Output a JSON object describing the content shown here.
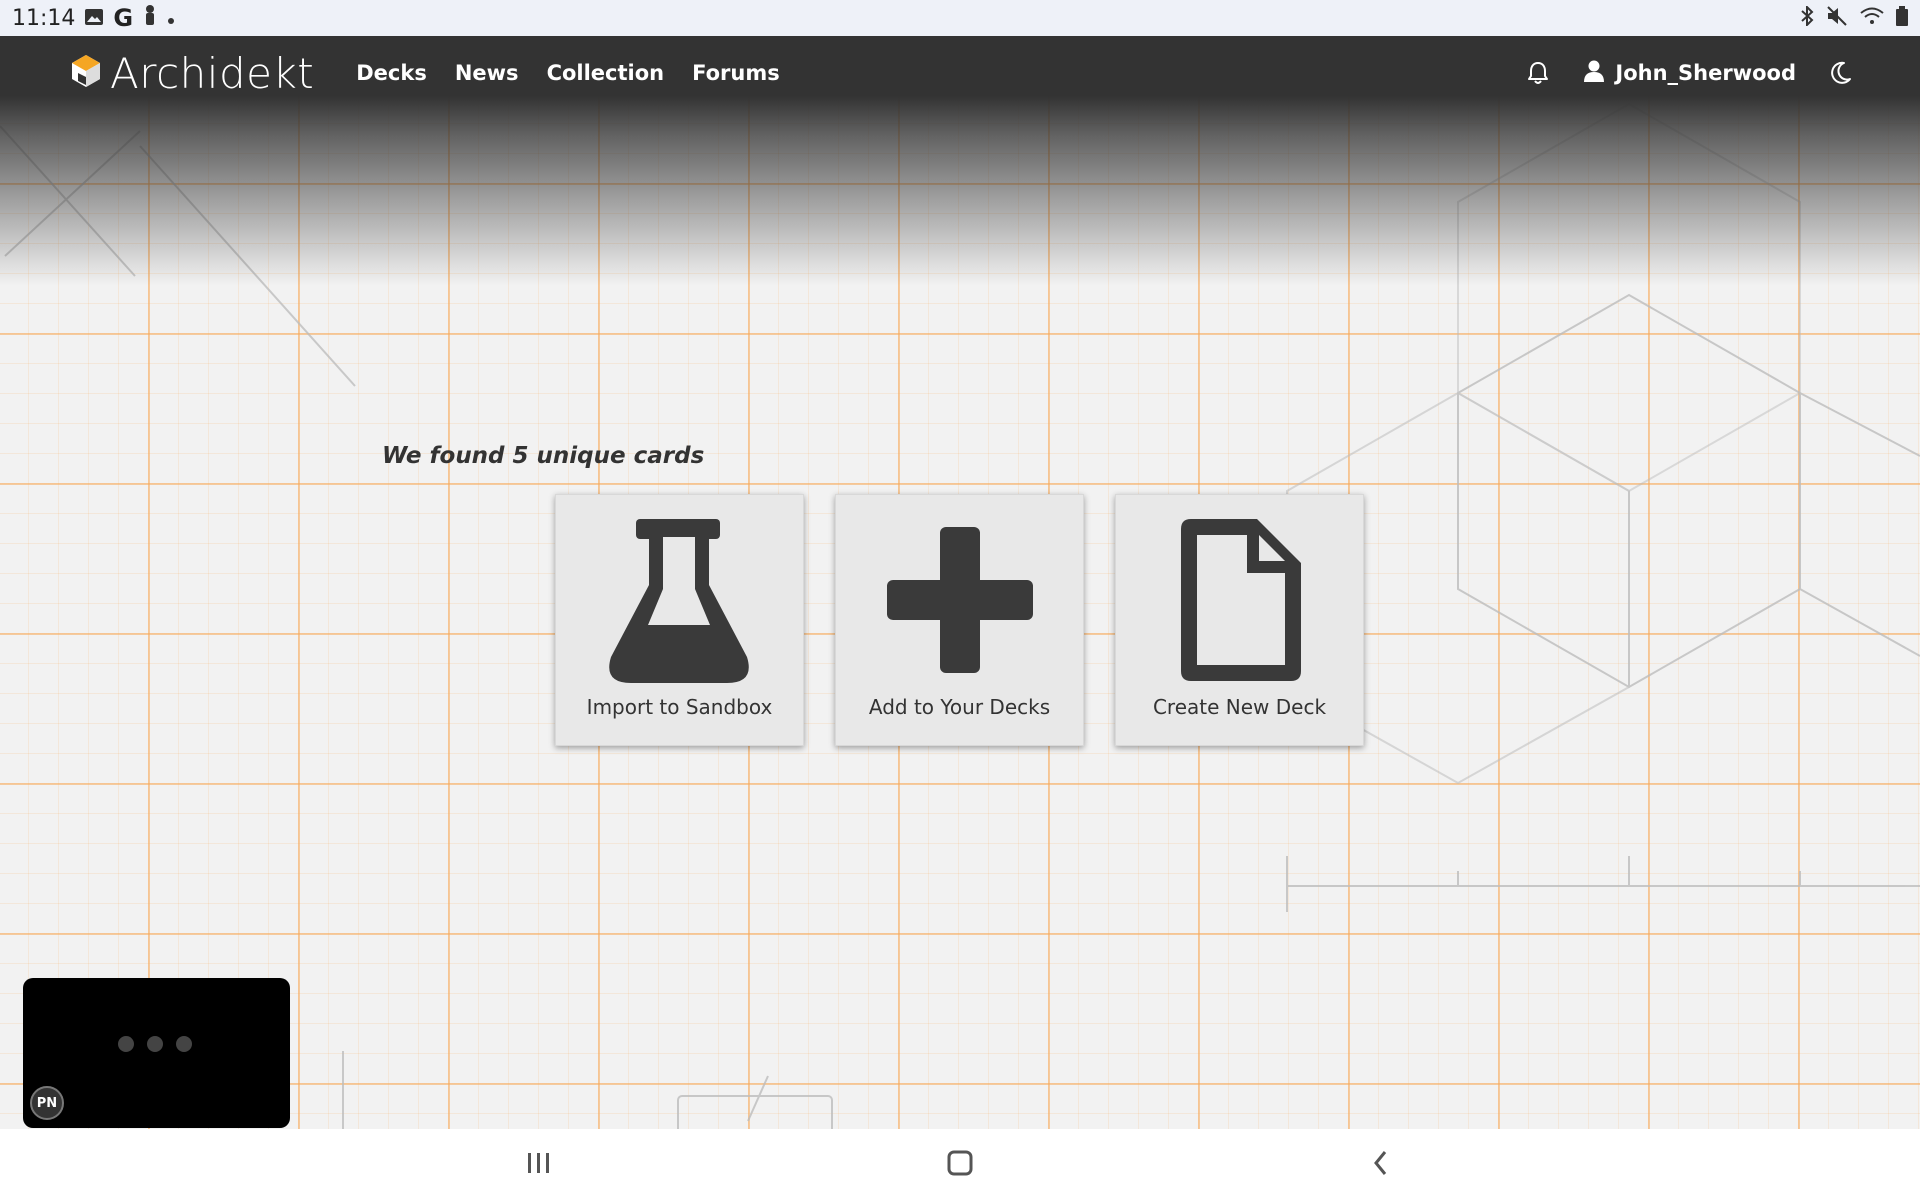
{
  "status_bar": {
    "time": "11:14",
    "left_icons": [
      "image-icon",
      "google-icon",
      "person-icon",
      "dot-icon"
    ],
    "right_icons": [
      "bluetooth-icon",
      "mute-icon",
      "wifi-icon",
      "battery-icon"
    ]
  },
  "navbar": {
    "brand": "Archidekt",
    "links": [
      {
        "label": "Decks"
      },
      {
        "label": "News"
      },
      {
        "label": "Collection"
      },
      {
        "label": "Forums"
      }
    ],
    "username": "John_Sherwood"
  },
  "main": {
    "found_message": "We found 5 unique cards",
    "options": [
      {
        "label": "Import to Sandbox",
        "icon": "flask-icon"
      },
      {
        "label": "Add to Your Decks",
        "icon": "plus-icon"
      },
      {
        "label": "Create New Deck",
        "icon": "file-icon"
      }
    ]
  },
  "mini_player": {
    "badge": "PN"
  },
  "colors": {
    "navbar": "#333333",
    "grid_line": "#f7aa5a",
    "icon_dark": "#3a3a3a",
    "card_bg": "#e8e8e8",
    "logo_accent": "#f5a623"
  }
}
